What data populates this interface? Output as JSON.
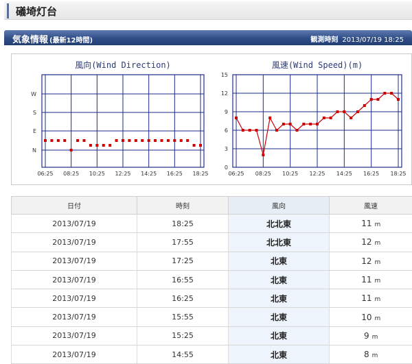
{
  "page": {
    "title": "礒埼灯台"
  },
  "section": {
    "title": "気象情報",
    "subtitle": "(最新12時間)",
    "obs_label": "観測時刻",
    "obs_time": "2013/07/19 18:25"
  },
  "chart_data": [
    {
      "type": "scatter",
      "title": "風向(Wind Direction)",
      "ylabel_ticks": [
        "W",
        "S",
        "E",
        "N"
      ],
      "xticks": [
        "06:25",
        "08:25",
        "10:25",
        "12:25",
        "14:25",
        "16:25",
        "18:25"
      ],
      "x": [
        "06:25",
        "06:55",
        "07:25",
        "07:55",
        "08:25",
        "08:55",
        "09:25",
        "09:55",
        "10:25",
        "10:55",
        "11:25",
        "11:55",
        "12:25",
        "12:55",
        "13:25",
        "13:55",
        "14:25",
        "14:55",
        "15:25",
        "15:55",
        "16:25",
        "16:55",
        "17:25",
        "17:55",
        "18:25"
      ],
      "y": [
        0.5,
        0.5,
        0.5,
        0.5,
        0,
        0.5,
        0.5,
        0.25,
        0.25,
        0.25,
        0.25,
        0.5,
        0.5,
        0.5,
        0.5,
        0.5,
        0.5,
        0.5,
        0.5,
        0.5,
        0.5,
        0.5,
        0.5,
        0.25,
        0.25
      ],
      "color": "#cc0000"
    },
    {
      "type": "line",
      "title": "風速(Wind Speed)(m)",
      "ylim": [
        0,
        15
      ],
      "yticks": [
        0,
        3,
        6,
        9,
        12,
        15
      ],
      "xticks": [
        "06:25",
        "08:25",
        "10:25",
        "12:25",
        "14:25",
        "16:25",
        "18:25"
      ],
      "x": [
        "06:25",
        "06:55",
        "07:25",
        "07:55",
        "08:25",
        "08:55",
        "09:25",
        "09:55",
        "10:25",
        "10:55",
        "11:25",
        "11:55",
        "12:25",
        "12:55",
        "13:25",
        "13:55",
        "14:25",
        "14:55",
        "15:25",
        "15:55",
        "16:25",
        "16:55",
        "17:25",
        "17:55",
        "18:25"
      ],
      "values": [
        8,
        6,
        6,
        6,
        2,
        8,
        6,
        7,
        7,
        6,
        7,
        7,
        7,
        8,
        8,
        9,
        9,
        8,
        9,
        10,
        11,
        11,
        12,
        12,
        11
      ],
      "color": "#cc0000"
    }
  ],
  "table": {
    "headers": [
      "日付",
      "時刻",
      "風向",
      "風速"
    ],
    "rows": [
      [
        "2013/07/19",
        "18:25",
        "北北東",
        "11"
      ],
      [
        "2013/07/19",
        "17:55",
        "北北東",
        "12"
      ],
      [
        "2013/07/19",
        "17:25",
        "北東",
        "12"
      ],
      [
        "2013/07/19",
        "16:55",
        "北東",
        "11"
      ],
      [
        "2013/07/19",
        "16:25",
        "北東",
        "11"
      ],
      [
        "2013/07/19",
        "15:55",
        "北東",
        "10"
      ],
      [
        "2013/07/19",
        "15:25",
        "北東",
        "9"
      ],
      [
        "2013/07/19",
        "14:55",
        "北東",
        "8"
      ]
    ],
    "unit": "m"
  },
  "colors": {
    "accent": "#2f4d86",
    "grid": "#1e2a8a",
    "series": "#cc0000"
  }
}
